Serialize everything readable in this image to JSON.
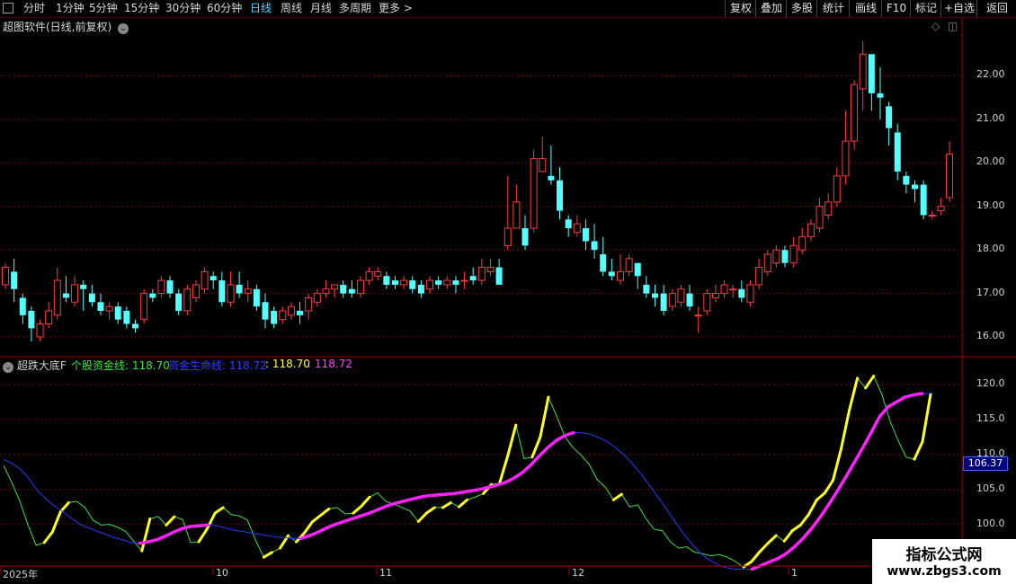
{
  "toolbar": {
    "periods": [
      "分时",
      "1分钟",
      "5分钟",
      "15分钟",
      "30分钟",
      "60分钟",
      "日线",
      "周线",
      "月线",
      "多周期",
      "更多 >"
    ],
    "active": "日线",
    "right_buttons": [
      "复权",
      "叠加",
      "多股",
      "统计",
      "画线",
      "F10",
      "标记",
      "+自选",
      "返回"
    ]
  },
  "main_title": "超图软件(日线,前复权)",
  "indicator": {
    "name": "超跌大底F",
    "line1_label": "个股资金线: 118.70",
    "line2_label": "资金生命线: 118.72",
    "line3_label": ": 118.70",
    "line4_label": ": 118.72",
    "last_value": "106.37"
  },
  "watermark": {
    "title": "指标公式网",
    "url": "www.zbgs3.com"
  },
  "colors": {
    "up": "#ff3c3c",
    "down": "#54ffff",
    "grid": "#7a0000",
    "green": "#40e040",
    "blue": "#1e3cff",
    "yellow": "#ffff20",
    "magenta": "#ff20ff"
  },
  "chart_data": [
    {
      "type": "candlestick",
      "ylim": [
        15.65,
        23.0
      ],
      "yticks": [
        "16.00",
        "17.00",
        "18.00",
        "19.00",
        "20.00",
        "21.00",
        "22.00"
      ],
      "candles": [
        [
          17.2,
          17.6,
          17.7,
          17.1
        ],
        [
          17.5,
          17.1,
          17.8,
          16.8
        ],
        [
          16.9,
          16.5,
          17.0,
          16.3
        ],
        [
          16.6,
          16.2,
          16.7,
          15.9
        ],
        [
          16.0,
          16.3,
          16.4,
          15.9
        ],
        [
          16.3,
          16.6,
          16.8,
          16.2
        ],
        [
          16.5,
          17.3,
          17.6,
          16.4
        ],
        [
          17.0,
          16.9,
          17.4,
          16.8
        ],
        [
          16.8,
          17.2,
          17.4,
          16.7
        ],
        [
          17.2,
          17.1,
          17.3,
          16.6
        ],
        [
          17.0,
          16.8,
          17.2,
          16.7
        ],
        [
          16.8,
          16.6,
          17.0,
          16.5
        ],
        [
          16.6,
          16.7,
          16.8,
          16.4
        ],
        [
          16.7,
          16.4,
          16.8,
          16.3
        ],
        [
          16.6,
          16.3,
          16.7,
          16.2
        ],
        [
          16.3,
          16.2,
          16.4,
          16.1
        ],
        [
          16.4,
          17.0,
          17.1,
          16.3
        ],
        [
          17.0,
          16.9,
          17.1,
          16.8
        ],
        [
          17.0,
          17.3,
          17.4,
          16.9
        ],
        [
          17.3,
          17.0,
          17.4,
          16.9
        ],
        [
          17.0,
          16.6,
          17.1,
          16.5
        ],
        [
          16.6,
          17.1,
          17.2,
          16.5
        ],
        [
          16.9,
          17.2,
          17.3,
          16.8
        ],
        [
          17.1,
          17.5,
          17.6,
          17.0
        ],
        [
          17.4,
          17.3,
          17.5,
          17.1
        ],
        [
          17.3,
          16.8,
          17.5,
          16.7
        ],
        [
          16.8,
          17.2,
          17.5,
          16.7
        ],
        [
          17.2,
          17.0,
          17.5,
          16.9
        ],
        [
          17.0,
          17.1,
          17.3,
          16.8
        ],
        [
          17.1,
          16.7,
          17.2,
          16.6
        ],
        [
          16.8,
          16.4,
          17.0,
          16.2
        ],
        [
          16.6,
          16.3,
          16.7,
          16.2
        ],
        [
          16.4,
          16.6,
          16.7,
          16.3
        ],
        [
          16.5,
          16.7,
          16.8,
          16.4
        ],
        [
          16.6,
          16.5,
          16.8,
          16.3
        ],
        [
          16.6,
          16.9,
          17.0,
          16.4
        ],
        [
          16.8,
          17.0,
          17.1,
          16.7
        ],
        [
          17.0,
          17.1,
          17.3,
          16.9
        ],
        [
          17.1,
          17.2,
          17.2,
          16.9
        ],
        [
          17.2,
          17.0,
          17.3,
          16.9
        ],
        [
          17.1,
          17.0,
          17.3,
          16.9
        ],
        [
          17.0,
          17.3,
          17.4,
          16.9
        ],
        [
          17.3,
          17.5,
          17.6,
          17.2
        ],
        [
          17.4,
          17.5,
          17.6,
          17.3
        ],
        [
          17.4,
          17.2,
          17.5,
          17.1
        ],
        [
          17.3,
          17.2,
          17.4,
          17.1
        ],
        [
          17.2,
          17.3,
          17.4,
          17.1
        ],
        [
          17.3,
          17.1,
          17.4,
          17.0
        ],
        [
          17.2,
          17.0,
          17.3,
          16.9
        ],
        [
          17.1,
          17.3,
          17.4,
          17.0
        ],
        [
          17.3,
          17.2,
          17.4,
          17.1
        ],
        [
          17.2,
          17.3,
          17.4,
          17.1
        ],
        [
          17.3,
          17.2,
          17.4,
          17.0
        ],
        [
          17.3,
          17.3,
          17.5,
          17.1
        ],
        [
          17.4,
          17.3,
          17.6,
          17.2
        ],
        [
          17.3,
          17.6,
          17.8,
          17.2
        ],
        [
          17.5,
          17.6,
          17.8,
          17.4
        ],
        [
          17.6,
          17.2,
          17.8,
          17.2
        ],
        [
          18.1,
          18.5,
          19.7,
          18.0
        ],
        [
          18.5,
          19.1,
          19.5,
          18.6
        ],
        [
          18.5,
          18.1,
          18.8,
          18.0
        ],
        [
          18.5,
          20.1,
          20.3,
          18.4
        ],
        [
          19.8,
          20.1,
          20.6,
          19.8
        ],
        [
          19.7,
          19.6,
          20.4,
          19.5
        ],
        [
          19.6,
          18.9,
          19.9,
          18.7
        ],
        [
          18.7,
          18.5,
          18.8,
          18.3
        ],
        [
          18.4,
          18.6,
          18.8,
          18.3
        ],
        [
          18.5,
          18.2,
          18.7,
          18.0
        ],
        [
          18.2,
          18.0,
          18.6,
          17.8
        ],
        [
          17.9,
          17.5,
          18.3,
          17.4
        ],
        [
          17.5,
          17.4,
          17.8,
          17.3
        ],
        [
          17.3,
          17.5,
          17.9,
          17.2
        ],
        [
          17.5,
          17.8,
          17.9,
          17.4
        ],
        [
          17.7,
          17.4,
          17.7,
          17.1
        ],
        [
          17.2,
          17.0,
          17.4,
          16.9
        ],
        [
          17.0,
          16.9,
          17.2,
          16.7
        ],
        [
          17.0,
          16.6,
          17.2,
          16.5
        ],
        [
          16.7,
          17.0,
          17.1,
          16.6
        ],
        [
          16.8,
          17.1,
          17.2,
          16.7
        ],
        [
          17.0,
          16.7,
          17.2,
          16.6
        ],
        [
          16.5,
          16.5,
          16.7,
          16.1
        ],
        [
          16.6,
          17.0,
          17.1,
          16.5
        ],
        [
          16.9,
          17.0,
          17.2,
          16.8
        ],
        [
          17.0,
          17.2,
          17.3,
          16.9
        ],
        [
          17.1,
          17.1,
          17.2,
          16.9
        ],
        [
          17.1,
          16.9,
          17.3,
          16.8
        ],
        [
          16.8,
          17.2,
          17.3,
          16.7
        ],
        [
          17.2,
          17.6,
          17.8,
          17.1
        ],
        [
          17.5,
          17.9,
          18.0,
          17.4
        ],
        [
          17.7,
          18.0,
          18.1,
          17.6
        ],
        [
          18.0,
          17.7,
          18.1,
          17.6
        ],
        [
          17.7,
          18.1,
          18.3,
          17.6
        ],
        [
          18.0,
          18.3,
          18.5,
          17.9
        ],
        [
          18.3,
          18.6,
          18.7,
          18.2
        ],
        [
          18.5,
          19.0,
          19.2,
          18.4
        ],
        [
          18.8,
          19.1,
          19.3,
          18.7
        ],
        [
          19.1,
          19.7,
          19.9,
          19.0
        ],
        [
          19.7,
          20.5,
          21.2,
          19.5
        ],
        [
          20.5,
          21.8,
          21.9,
          20.3
        ],
        [
          21.7,
          22.5,
          22.8,
          21.2
        ],
        [
          22.5,
          21.6,
          22.3,
          21.2
        ],
        [
          21.6,
          21.5,
          22.2,
          21.0
        ],
        [
          21.3,
          20.8,
          21.4,
          20.4
        ],
        [
          20.7,
          19.8,
          20.9,
          19.6
        ],
        [
          19.7,
          19.5,
          19.8,
          19.3
        ],
        [
          19.5,
          19.4,
          19.6,
          19.1
        ],
        [
          19.5,
          18.8,
          19.6,
          18.7
        ],
        [
          18.8,
          18.8,
          18.9,
          18.7
        ],
        [
          18.9,
          19.0,
          19.2,
          18.8
        ],
        [
          19.2,
          20.2,
          20.5,
          19.1
        ]
      ]
    },
    {
      "type": "line",
      "ylim": [
        94.3,
        122.3
      ],
      "yticks": [
        "100.0",
        "105.0",
        "110.0",
        "115.0",
        "120.0"
      ],
      "x_labels": [
        "2025年",
        "10",
        "11",
        "12",
        "1"
      ],
      "series": [
        {
          "name": "个股资金线",
          "values": [
            108.4,
            106,
            103.3,
            99.9,
            97,
            97.4,
            98.9,
            101.8,
            103.1,
            103.3,
            102.4,
            100.6,
            99.9,
            100,
            99.6,
            99,
            97.6,
            96.2,
            100.8,
            101.1,
            99.9,
            101.1,
            100.7,
            97.4,
            97.5,
            99.3,
            101.6,
            102.4,
            101.4,
            101.2,
            100.6,
            97.7,
            95.3,
            96,
            96.6,
            98.4,
            97.5,
            98.8,
            100.4,
            101.3,
            102.2,
            102.4,
            101.5,
            101.6,
            102.6,
            103.9,
            104.5,
            103.3,
            102.9,
            102.4,
            101.9,
            100.4,
            101.6,
            102.4,
            102.4,
            103.1,
            102.5,
            103.5,
            103.9,
            104.4,
            105.7,
            105.9,
            109.8,
            114.2,
            109.4,
            109.6,
            112.5,
            118.2,
            115.5,
            112.6,
            111,
            109.9,
            108.6,
            106.4,
            105.3,
            103.5,
            104.3,
            102.5,
            102.8,
            100.8,
            99.3,
            99.1,
            97.5,
            96.6,
            96.8,
            96,
            95.8,
            95.5,
            95.7,
            95.3,
            94.7,
            93.9,
            94.7,
            96.1,
            97.3,
            98.4,
            97.6,
            99.1,
            99.9,
            101.4,
            103.5,
            104.5,
            106.3,
            110.8,
            116.3,
            120.9,
            119.5,
            121.2,
            118.6,
            114.8,
            112,
            109.6,
            109.3,
            111.8,
            118.6
          ]
        },
        {
          "name": "资金生命线",
          "values": [
            109.3,
            108.7,
            107.9,
            106.5,
            104.8,
            103.6,
            102.6,
            101.8,
            100.8,
            100,
            99.5,
            99,
            98.6,
            98.1,
            97.8,
            97.4,
            97.3,
            97.5,
            97.8,
            98.3,
            98.9,
            99.4,
            99.7,
            99.8,
            99.9,
            99.8,
            99.5,
            99.2,
            99,
            98.8,
            98.6,
            98.4,
            98.2,
            98.1,
            98,
            98,
            98.4,
            98.9,
            99.5,
            100,
            100.4,
            100.8,
            101.2,
            101.6,
            102.1,
            102.6,
            103,
            103.3,
            103.6,
            103.9,
            104.1,
            104.2,
            104.3,
            104.4,
            104.6,
            104.8,
            105,
            105.3,
            105.6,
            106,
            106.6,
            107.4,
            108.5,
            109.8,
            111,
            112,
            112.7,
            113.1,
            113.1,
            112.9,
            112.4,
            111.8,
            110.9,
            109.9,
            108.6,
            107.1,
            105.5,
            103.8,
            102.1,
            100.3,
            98.6,
            97.1,
            95.8,
            94.9,
            94.2,
            93.8,
            93.6,
            93.6,
            93.6,
            94.1,
            94.6,
            95.1,
            95.8,
            96.8,
            98,
            99.4,
            101,
            102.8,
            104.7,
            106.7,
            108.8,
            110.9,
            113.1,
            115.4,
            116.8,
            117.5,
            118.2,
            118.5,
            118.7,
            118.72
          ]
        }
      ]
    }
  ]
}
